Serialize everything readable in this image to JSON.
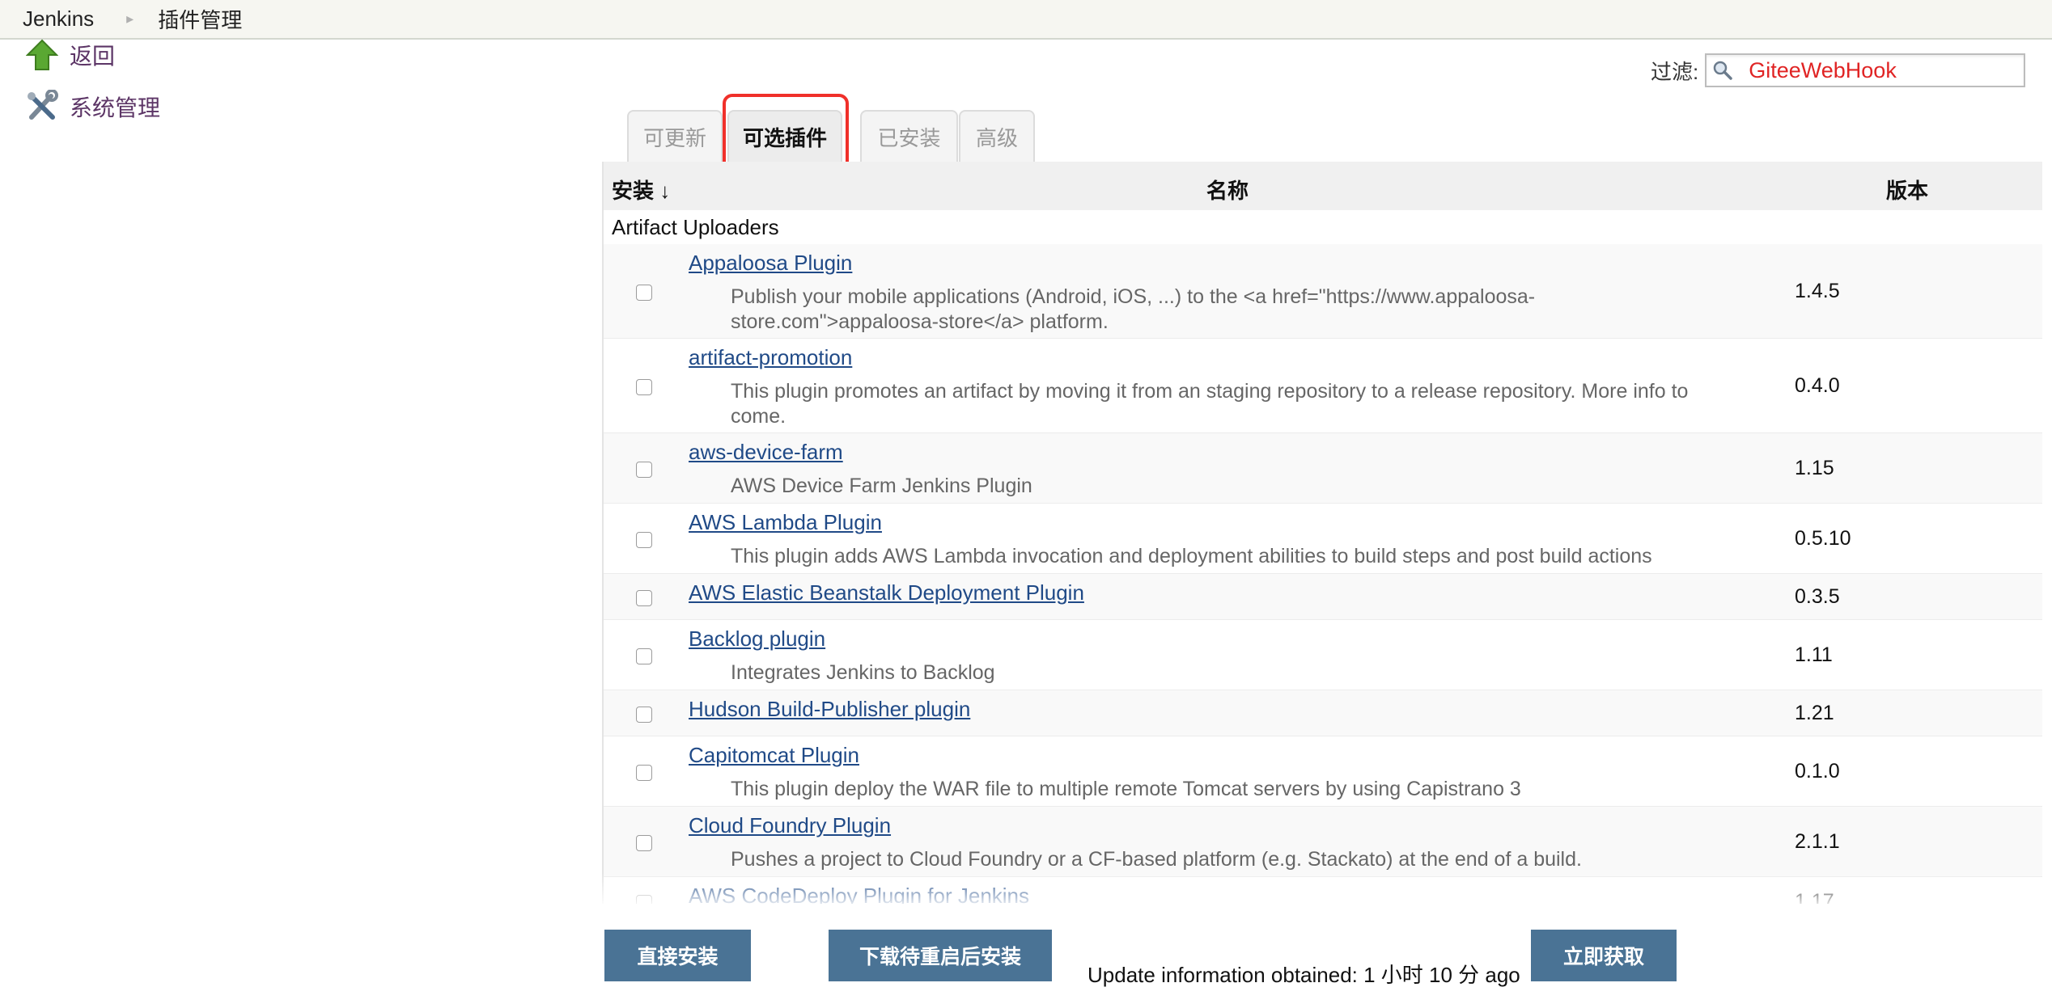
{
  "breadcrumb": {
    "root": "Jenkins",
    "current": "插件管理"
  },
  "side": {
    "back_label": "返回",
    "manage_label": "系统管理"
  },
  "filter": {
    "label": "过滤:",
    "value": "GiteeWebHook"
  },
  "tabs": [
    "可更新",
    "可选插件",
    "已安装",
    "高级"
  ],
  "active_tab": "可选插件",
  "table": {
    "headers": {
      "install": "安装 ↓",
      "name": "名称",
      "version": "版本"
    },
    "category": "Artifact Uploaders",
    "rows": [
      {
        "name": "Appaloosa Plugin",
        "desc1": "Publish your mobile applications (Android, iOS, ...) to the <a href=\"https://www.appaloosa-",
        "desc2": "store.com\">appaloosa-store</a> platform.",
        "version": "1.4.5"
      },
      {
        "name": "artifact-promotion",
        "desc1": "This plugin promotes an artifact by moving it from an staging repository to a release repository. More info to",
        "desc2": "come.",
        "version": "0.4.0"
      },
      {
        "name": "aws-device-farm",
        "desc1": "AWS Device Farm Jenkins Plugin",
        "desc2": "",
        "version": "1.15"
      },
      {
        "name": "AWS Lambda Plugin",
        "desc1": "This plugin adds AWS Lambda invocation and deployment abilities to build steps and post build actions",
        "desc2": "",
        "version": "0.5.10"
      },
      {
        "name": "AWS Elastic Beanstalk Deployment Plugin",
        "desc1": "",
        "desc2": "",
        "version": "0.3.5"
      },
      {
        "name": "Backlog plugin",
        "desc1": "Integrates Jenkins to Backlog",
        "desc2": "",
        "version": "1.11"
      },
      {
        "name": "Hudson Build-Publisher plugin",
        "desc1": "",
        "desc2": "",
        "version": "1.21"
      },
      {
        "name": "Capitomcat Plugin",
        "desc1": "This plugin deploy the WAR file to multiple remote Tomcat servers by using Capistrano 3",
        "desc2": "",
        "version": "0.1.0"
      },
      {
        "name": "Cloud Foundry Plugin",
        "desc1": "Pushes a project to Cloud Foundry or a CF-based platform (e.g. Stackato) at the end of a build.",
        "desc2": "",
        "version": "2.1.1"
      },
      {
        "name": "AWS CodeDeploy Plugin for Jenkins",
        "desc1": "",
        "desc2": "",
        "version": "1.17"
      }
    ]
  },
  "buttons": {
    "install_now": "直接安装",
    "install_after_restart": "下载待重启后安装",
    "fetch_now": "立即获取"
  },
  "update_info": "Update information obtained: 1 小时 10 分 ago",
  "colors": {
    "link": "#204a87",
    "button": "#4a7395",
    "highlight": "#f0302a",
    "filter_text": "#e02424"
  }
}
